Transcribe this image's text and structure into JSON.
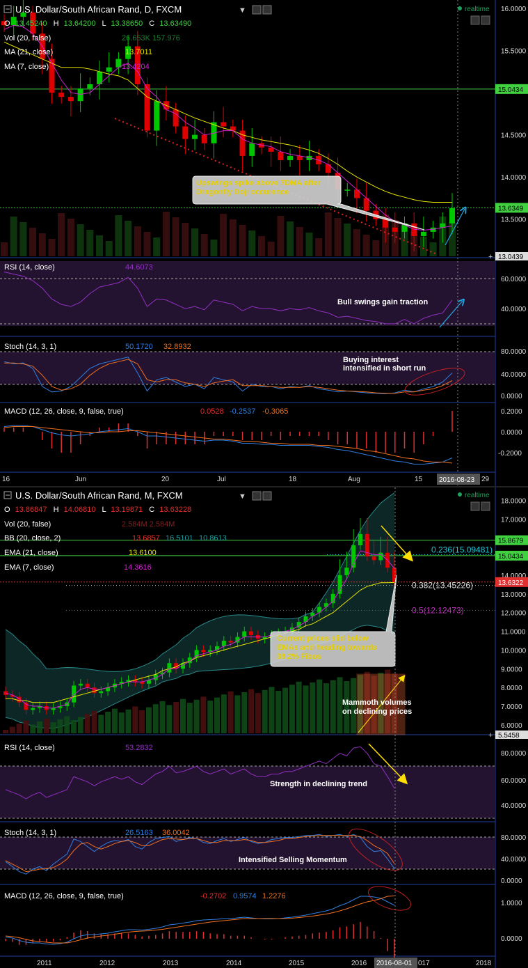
{
  "colors": {
    "background": "#000000",
    "up": "#00c800",
    "down": "#e00000",
    "ma21": "#e6e600",
    "ma7": "#d020d0",
    "rsi": "#9030c0",
    "stoch_k": "#2f7fe0",
    "stoch_d": "#f07020",
    "macd": "#2f7fe0",
    "signal": "#f07020",
    "hist": "#e03030",
    "panel_fill": "#241330",
    "axis_label_bg": "#1a1a1a",
    "green_line": "#40d040",
    "fib_cyan": "#20c8d8",
    "fib_white": "#dddddd",
    "fib_purple": "#c030c0"
  },
  "daily": {
    "title": "U.S. Dollar/South African Rand, D, FXCM",
    "ohlc": {
      "o_label": "O",
      "o": "13.45240",
      "h_label": "H",
      "h": "13.64200",
      "l_label": "L",
      "l": "13.38650",
      "c_label": "C",
      "c": "13.63490"
    },
    "realtime": "realtime",
    "vol_label": "Vol (20, false)",
    "vol_values": "26.653K  157.976",
    "ma21_label": "MA (21, close)",
    "ma21_value": "13.7011",
    "ma7_label": "MA (7, close)",
    "ma7_value": "13.4204",
    "rsi_label": "RSI (14, close)",
    "rsi_value": "44.6073",
    "stoch_label": "Stoch (14, 3, 1)",
    "stoch_k_value": "50.1720",
    "stoch_d_value": "32.8932",
    "macd_label": "MACD (12, 26, close, 9, false, true)",
    "macd_hist_value": "0.0528",
    "macd_value": "-0.2537",
    "macd_signal_value": "-0.3065",
    "price_ticks": [
      "16.0000",
      "15.5000",
      "14.5000",
      "14.0000",
      "13.5000"
    ],
    "price_tick_values": [
      16.0,
      15.5,
      14.5,
      14.0,
      13.5
    ],
    "price_range": [
      13.06,
      16.0
    ],
    "h_line_value": 15.0434,
    "h_line_label": "15.0434",
    "last_price": 13.6349,
    "last_price_label": "13.6349",
    "bottom_tag": "13.0439",
    "rsi_ticks": [
      "60.0000",
      "40.0000"
    ],
    "stoch_ticks": [
      "80.0000",
      "40.0000",
      "0.0000"
    ],
    "macd_ticks": [
      "0.2000",
      "0.0000",
      "-0.2000"
    ],
    "x_labels": [
      "16",
      "Jun",
      "20",
      "Jul",
      "18",
      "Aug",
      "15",
      "2016-08-23",
      "29"
    ],
    "annotation_box": "Upswings spike above 7DMA after Dragonfly Doji occurence",
    "annotation_rsi": "Bull swings gain traction",
    "annotation_stoch": "Buying interest intensified in short run",
    "plus_sign": "+"
  },
  "monthly": {
    "title": "U.S. Dollar/South African Rand, M, FXCM",
    "ohlc": {
      "o_label": "O",
      "o": "13.86847",
      "h_label": "H",
      "h": "14.06810",
      "l_label": "L",
      "l": "13.19871",
      "c_label": "C",
      "c": "13.63228"
    },
    "realtime": "realtime",
    "vol_label": "Vol (20, false)",
    "vol_values": "2.584M  2.584M",
    "bb_label": "BB (20, close, 2)",
    "bb_values": [
      "13.6857",
      "16.5101",
      "10.8613"
    ],
    "ema21_label": "EMA (21, close)",
    "ema21_value": "13.6100",
    "ema7_label": "EMA (7, close)",
    "ema7_value": "14.3616",
    "rsi_label": "RSI (14, close)",
    "rsi_value": "53.2832",
    "stoch_label": "Stoch (14, 3, 1)",
    "stoch_k_value": "26.5163",
    "stoch_d_value": "36.0042",
    "macd_label": "MACD (12, 26, close, 9, false, true)",
    "macd_hist_value": "-0.2702",
    "macd_value": "0.9574",
    "macd_signal_value": "1.2276",
    "price_ticks": [
      "18.0000",
      "17.0000",
      "16.0000",
      "14.0000",
      "13.0000",
      "12.0000",
      "11.0000",
      "10.0000",
      "9.0000",
      "8.0000",
      "7.0000",
      "6.0000"
    ],
    "price_tick_values": [
      18,
      17,
      16,
      14,
      13,
      12,
      11,
      10,
      9,
      8,
      7,
      6
    ],
    "price_range": [
      5.55,
      18.5
    ],
    "green_line_1": 15.8679,
    "green_line_1_label": "15.8679",
    "green_line_2": 15.0434,
    "green_line_2_label": "15.0434",
    "last_price": 13.6322,
    "last_price_label": "13.6322",
    "bottom_tag": "5.5458",
    "fib_236_label": "0.236(15.09481)",
    "fib_382_label": "0.382(13.45226)",
    "fib_50_label": "0.5(12.12473)",
    "fib_236": 15.09481,
    "fib_382": 13.45226,
    "fib_50": 12.12473,
    "rsi_ticks": [
      "80.0000",
      "60.0000",
      "40.0000"
    ],
    "stoch_ticks": [
      "80.0000",
      "40.0000",
      "0.0000"
    ],
    "macd_ticks": [
      "1.0000",
      "0.0000"
    ],
    "x_labels": [
      "2011",
      "2012",
      "2013",
      "2014",
      "2015",
      "2016",
      "2016-08-01",
      "017",
      "2018"
    ],
    "annotation_box": "Current prices slid below EMAs and heading towards 38.2% Fibos",
    "annotation_volume": "Mammoth volumes on declining prices",
    "annotation_rsi": "Strength in declining trend",
    "annotation_stoch": "Intensified Selling Momentum",
    "plus_sign": "+"
  },
  "chart_data": [
    {
      "type": "candlestick",
      "title": "U.S. Dollar/South African Rand, D, FXCM",
      "x": [
        "May 16",
        "Jun",
        "Jun 20",
        "Jul",
        "Jul 18",
        "Aug",
        "Aug 15",
        "2016-08-23",
        "Aug 29"
      ],
      "ylim": [
        13.06,
        16.0
      ],
      "series": [
        {
          "name": "Price",
          "values": [
            15.8,
            15.9,
            15.95,
            15.7,
            15.4,
            15.0,
            14.95,
            14.9,
            15.05,
            15.1,
            15.25,
            15.3,
            15.4,
            15.55,
            15.1,
            14.55,
            14.9,
            14.8,
            14.6,
            14.45,
            14.5,
            14.4,
            14.65,
            14.6,
            14.55,
            14.25,
            14.4,
            14.35,
            14.3,
            14.2,
            14.25,
            14.2,
            14.25,
            14.15,
            14.05,
            13.85,
            13.85,
            13.75,
            13.6,
            13.5,
            13.4,
            13.35,
            13.45,
            13.3,
            13.35,
            13.4,
            13.45,
            13.63
          ]
        },
        {
          "name": "MA (21, close)",
          "values": [
            15.6,
            15.55,
            15.5,
            15.45,
            15.4,
            15.35,
            15.3,
            15.3,
            15.3,
            15.28,
            15.25,
            15.22,
            15.2,
            15.15,
            15.05,
            14.95,
            14.9,
            14.85,
            14.8,
            14.75,
            14.7,
            14.66,
            14.62,
            14.58,
            14.55,
            14.5,
            14.47,
            14.44,
            14.42,
            14.4,
            14.38,
            14.35,
            14.32,
            14.28,
            14.22,
            14.15,
            14.07,
            14.0,
            13.94,
            13.88,
            13.83,
            13.79,
            13.76,
            13.73,
            13.71,
            13.7,
            13.7,
            13.7
          ]
        },
        {
          "name": "MA (7, close)",
          "values": [
            15.75,
            15.8,
            15.78,
            15.7,
            15.55,
            15.35,
            15.15,
            15.0,
            14.98,
            15.0,
            15.1,
            15.2,
            15.3,
            15.35,
            15.25,
            15.05,
            14.95,
            14.8,
            14.75,
            14.65,
            14.58,
            14.5,
            14.52,
            14.55,
            14.55,
            14.45,
            14.4,
            14.38,
            14.36,
            14.3,
            14.27,
            14.25,
            14.23,
            14.2,
            14.15,
            14.05,
            13.95,
            13.85,
            13.75,
            13.65,
            13.55,
            13.47,
            13.43,
            13.38,
            13.37,
            13.38,
            13.4,
            13.42
          ]
        }
      ]
    },
    {
      "type": "candlestick",
      "title": "U.S. Dollar/South African Rand, M, FXCM",
      "x": [
        "2011",
        "2012",
        "2013",
        "2014",
        "2015",
        "2016",
        "2016-08-01",
        "2017",
        "2018"
      ],
      "ylim": [
        5.55,
        18.5
      ],
      "series": [
        {
          "name": "Price",
          "values": [
            7.6,
            7.5,
            7.2,
            6.8,
            6.9,
            7.0,
            6.8,
            6.9,
            7.0,
            7.2,
            8.1,
            8.2,
            8.0,
            7.7,
            7.8,
            8.0,
            8.2,
            8.3,
            8.4,
            8.3,
            8.2,
            8.4,
            8.7,
            8.8,
            9.3,
            9.0,
            9.3,
            9.6,
            10.0,
            9.9,
            10.0,
            10.2,
            10.5,
            10.4,
            10.7,
            11.0,
            10.8,
            10.6,
            10.7,
            10.8,
            10.9,
            11.0,
            11.2,
            11.5,
            11.8,
            12.0,
            12.3,
            12.5,
            13.0,
            14.0,
            14.4,
            15.6,
            16.2,
            15.0,
            14.8,
            15.2,
            14.4,
            13.6
          ]
        },
        {
          "name": "EMA (21, close)",
          "values": [
            7.4,
            7.4,
            7.3,
            7.3,
            7.2,
            7.2,
            7.2,
            7.2,
            7.3,
            7.4,
            7.5,
            7.6,
            7.7,
            7.8,
            7.9,
            8.0,
            8.1,
            8.2,
            8.3,
            8.4,
            8.5,
            8.6,
            8.7,
            8.9,
            9.0,
            9.1,
            9.3,
            9.4,
            9.6,
            9.7,
            9.8,
            9.9,
            10.0,
            10.1,
            10.2,
            10.3,
            10.4,
            10.5,
            10.6,
            10.7,
            10.8,
            10.9,
            11.0,
            11.1,
            11.3,
            11.4,
            11.6,
            11.8,
            12.0,
            12.3,
            12.6,
            12.9,
            13.2,
            13.4,
            13.5,
            13.6,
            13.6,
            13.61
          ]
        },
        {
          "name": "EMA (7, close)",
          "values": [
            7.7,
            7.6,
            7.4,
            7.1,
            7.0,
            7.0,
            6.9,
            6.9,
            7.0,
            7.1,
            7.6,
            7.9,
            8.0,
            7.9,
            7.9,
            8.0,
            8.1,
            8.2,
            8.3,
            8.3,
            8.3,
            8.4,
            8.5,
            8.7,
            9.0,
            9.0,
            9.2,
            9.4,
            9.7,
            9.8,
            9.9,
            10.0,
            10.2,
            10.3,
            10.5,
            10.7,
            10.7,
            10.7,
            10.7,
            10.8,
            10.9,
            11.0,
            11.1,
            11.3,
            11.5,
            11.8,
            12.0,
            12.3,
            12.6,
            13.2,
            13.8,
            14.6,
            15.3,
            15.2,
            15.1,
            15.1,
            14.8,
            14.36
          ]
        }
      ]
    }
  ]
}
